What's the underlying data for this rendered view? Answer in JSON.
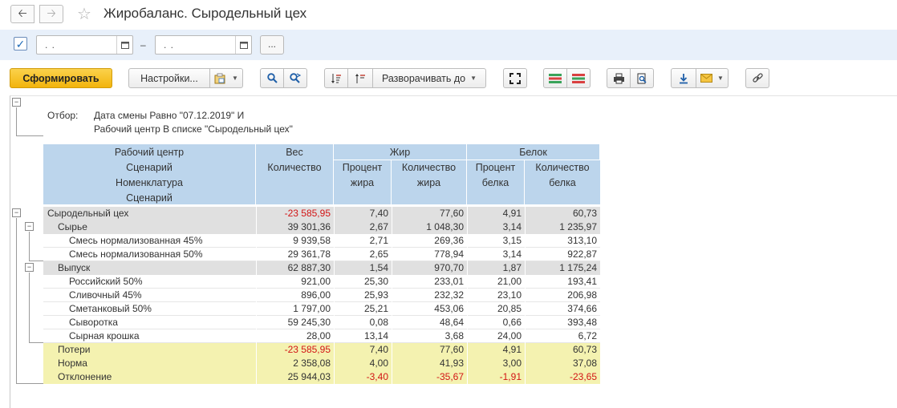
{
  "window": {
    "title": "Жиробаланс. Сыродельный цех"
  },
  "period": {
    "from": ".   .",
    "to": ".   .",
    "dash": "–",
    "more": "..."
  },
  "toolbar": {
    "generate": "Сформировать",
    "settings": "Настройки...",
    "expand_to": "Разворачивать до"
  },
  "filter": {
    "label": "Отбор:",
    "line1": "Дата смены Равно \"07.12.2019\" И",
    "line2": "Рабочий центр В списке \"Сыродельный цех\""
  },
  "table": {
    "header": {
      "dim": [
        "Рабочий центр",
        "Сценарий",
        "Номенклатура",
        "Сценарий"
      ],
      "weight_group": "Вес",
      "weight_qty": "Количество",
      "fat_group": "Жир",
      "fat_pct": [
        "Процент",
        "жира"
      ],
      "fat_qty": [
        "Количество",
        "жира"
      ],
      "protein_group": "Белок",
      "protein_pct": [
        "Процент",
        "белка"
      ],
      "protein_qty": [
        "Количество",
        "белка"
      ]
    },
    "rows": [
      {
        "name": "Сыродельный цех",
        "level": 0,
        "style": "gray",
        "v": [
          "-23 585,95",
          "7,40",
          "77,60",
          "4,91",
          "60,73"
        ]
      },
      {
        "name": "Сырье",
        "level": 1,
        "style": "gray",
        "v": [
          "39 301,36",
          "2,67",
          "1 048,30",
          "3,14",
          "1 235,97"
        ]
      },
      {
        "name": "Смесь нормализованная 45%",
        "level": 2,
        "style": "white",
        "v": [
          "9 939,58",
          "2,71",
          "269,36",
          "3,15",
          "313,10"
        ]
      },
      {
        "name": "Смесь нормализованная 50%",
        "level": 2,
        "style": "white",
        "v": [
          "29 361,78",
          "2,65",
          "778,94",
          "3,14",
          "922,87"
        ]
      },
      {
        "name": "Выпуск",
        "level": 1,
        "style": "gray",
        "v": [
          "62 887,30",
          "1,54",
          "970,70",
          "1,87",
          "1 175,24"
        ]
      },
      {
        "name": "Российский 50%",
        "level": 2,
        "style": "white",
        "v": [
          "921,00",
          "25,30",
          "233,01",
          "21,00",
          "193,41"
        ]
      },
      {
        "name": "Сливочный 45%",
        "level": 2,
        "style": "white",
        "v": [
          "896,00",
          "25,93",
          "232,32",
          "23,10",
          "206,98"
        ]
      },
      {
        "name": "Сметанковый 50%",
        "level": 2,
        "style": "white",
        "v": [
          "1 797,00",
          "25,21",
          "453,06",
          "20,85",
          "374,66"
        ]
      },
      {
        "name": "Сыворотка",
        "level": 2,
        "style": "white",
        "v": [
          "59 245,30",
          "0,08",
          "48,64",
          "0,66",
          "393,48"
        ]
      },
      {
        "name": "Сырная крошка",
        "level": 2,
        "style": "white",
        "v": [
          "28,00",
          "13,14",
          "3,68",
          "24,00",
          "6,72"
        ]
      },
      {
        "name": "Потери",
        "level": 1,
        "style": "yellow",
        "v": [
          "-23 585,95",
          "7,40",
          "77,60",
          "4,91",
          "60,73"
        ]
      },
      {
        "name": "Норма",
        "level": 1,
        "style": "yellow",
        "v": [
          "2 358,08",
          "4,00",
          "41,93",
          "3,00",
          "37,08"
        ]
      },
      {
        "name": "Отклонение",
        "level": 1,
        "style": "yellow",
        "v": [
          "25 944,03",
          "-3,40",
          "-35,67",
          "-1,91",
          "-23,65"
        ]
      }
    ]
  }
}
